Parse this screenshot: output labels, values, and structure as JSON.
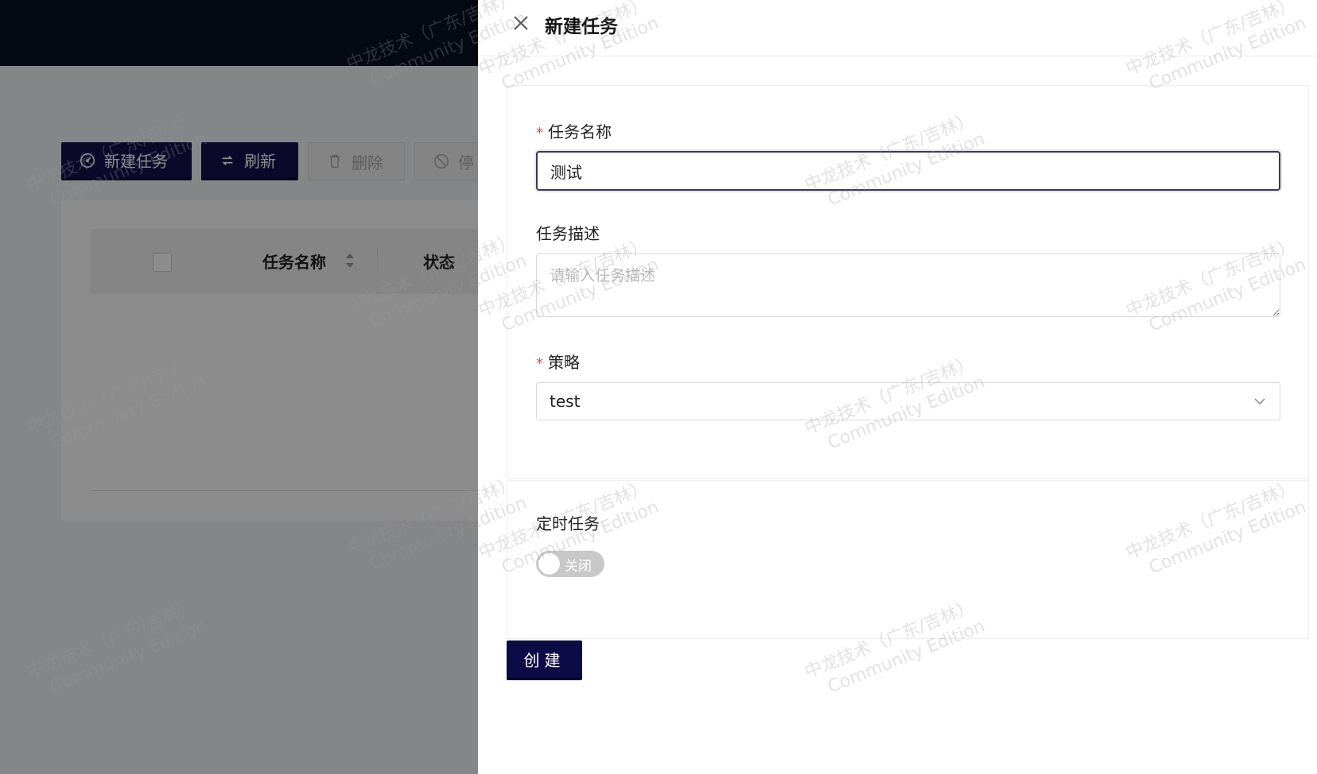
{
  "toolbar": {
    "create_label": "新建任务",
    "refresh_label": "刷新",
    "delete_label": "删除",
    "stop_label": "停"
  },
  "table": {
    "columns": [
      "任务名称",
      "状态"
    ]
  },
  "drawer": {
    "title": "新建任务",
    "fields": {
      "name_label": "任务名称",
      "name_value": "测试",
      "desc_label": "任务描述",
      "desc_placeholder": "请输入任务描述",
      "strategy_label": "策略",
      "strategy_value": "test",
      "schedule_label": "定时任务",
      "schedule_toggle_text": "关闭"
    },
    "submit_label": "创建"
  },
  "watermark": {
    "line1": "中龙技术（广东/吉林）",
    "line2": "Community Edition"
  },
  "colors": {
    "topbar": "#0a1322",
    "primary_button": "#14124d",
    "required_star": "#e5484d"
  }
}
